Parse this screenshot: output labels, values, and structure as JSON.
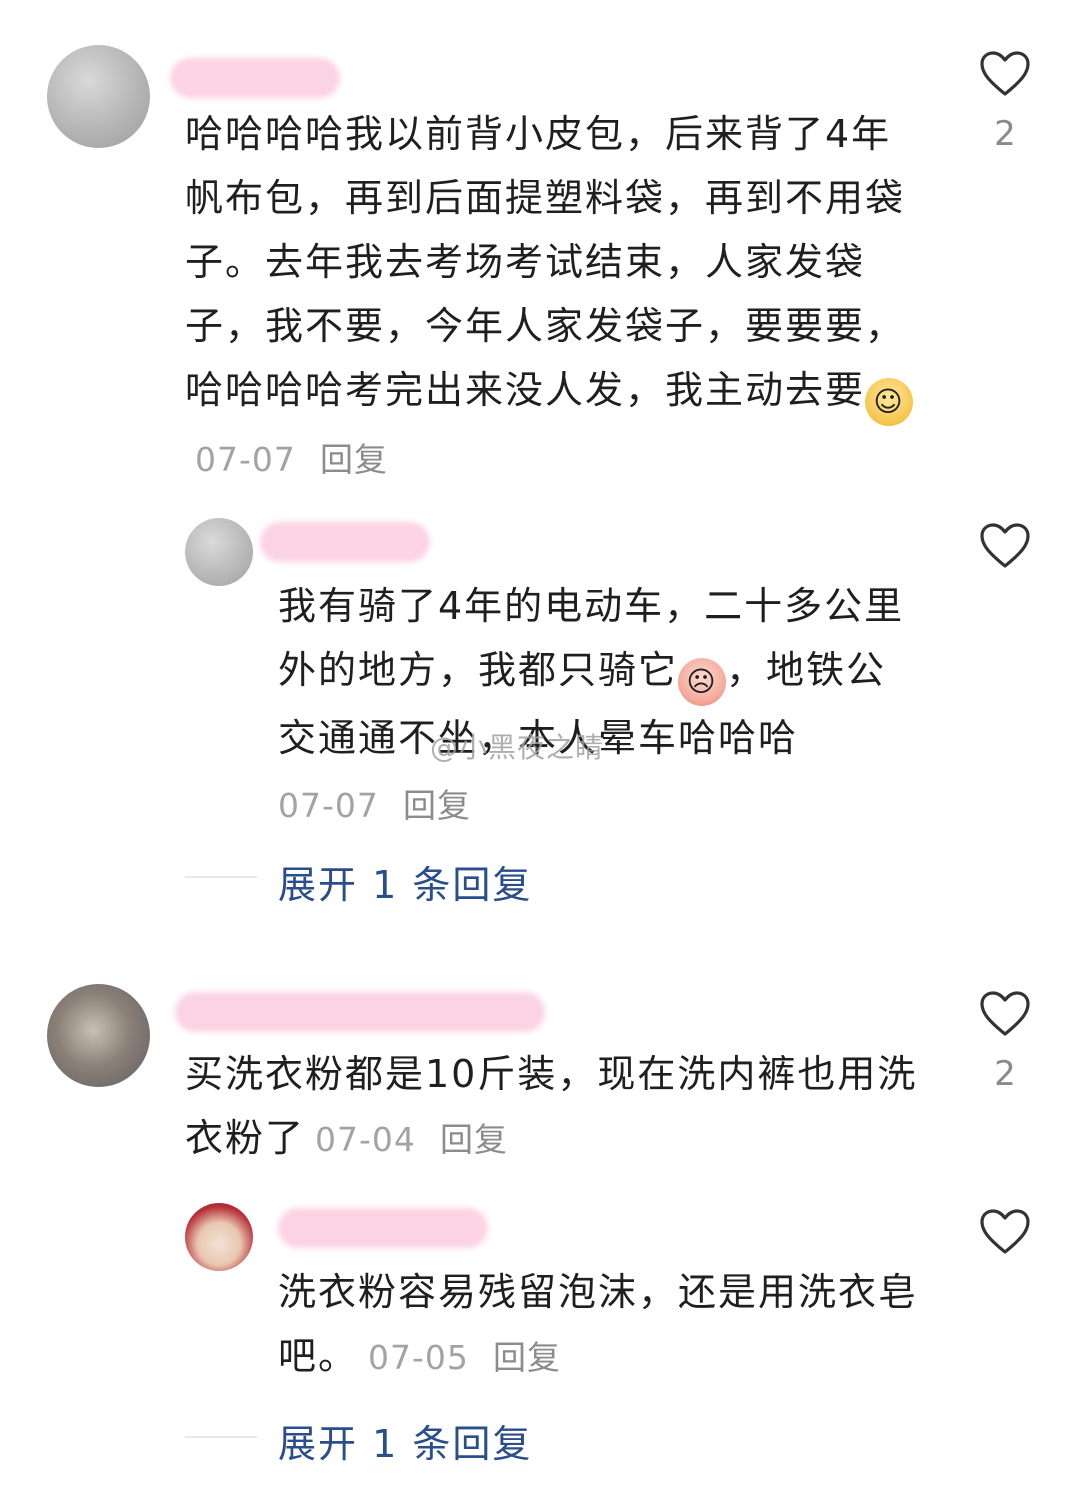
{
  "comments": [
    {
      "text": "哈哈哈哈我以前背小皮包，后来背了4年帆布包，再到后面提塑料袋，再到不用袋子。去年我去考场考试结束，人家发袋子，我不要，今年人家发袋子，要要要，哈哈哈哈考完出来没人发，我主动去要",
      "emoji": "lion-face-emoji",
      "date": "07-07",
      "reply_label": "回复",
      "likes": "2",
      "replies": [
        {
          "text": "我有骑了4年的电动车，二十多公里外的地方，我都只骑它",
          "emoji": "crying-face-emoji",
          "text_after": "，地铁公交通通不坐，本人晕车哈哈哈",
          "date": "07-07",
          "reply_label": "回复"
        }
      ],
      "expand_label": "展开 1 条回复"
    },
    {
      "text": "买洗衣粉都是10斤装，现在洗内裤也用洗衣粉了",
      "date": "07-04",
      "reply_label": "回复",
      "likes": "2",
      "replies": [
        {
          "text": "洗衣粉容易残留泡沫，还是用洗衣皂吧。",
          "date": "07-05",
          "reply_label": "回复"
        }
      ],
      "expand_label": "展开 1 条回复"
    }
  ],
  "watermark": "@小黑夜之睛",
  "colors": {
    "link": "#2a4d8c",
    "meta": "#a3a3a3",
    "name_blur": "#fbd3e3"
  }
}
